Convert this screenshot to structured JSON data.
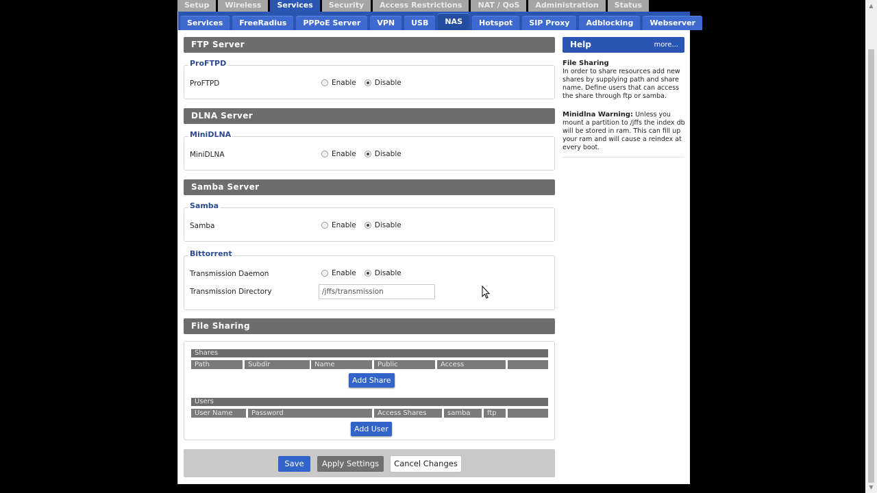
{
  "main_tabs": [
    {
      "label": "Setup",
      "active": false
    },
    {
      "label": "Wireless",
      "active": false
    },
    {
      "label": "Services",
      "active": true
    },
    {
      "label": "Security",
      "active": false
    },
    {
      "label": "Access Restrictions",
      "active": false
    },
    {
      "label": "NAT / QoS",
      "active": false
    },
    {
      "label": "Administration",
      "active": false
    },
    {
      "label": "Status",
      "active": false
    }
  ],
  "sub_tabs": [
    {
      "label": "Services",
      "active": false
    },
    {
      "label": "FreeRadius",
      "active": false
    },
    {
      "label": "PPPoE Server",
      "active": false
    },
    {
      "label": "VPN",
      "active": false
    },
    {
      "label": "USB",
      "active": false
    },
    {
      "label": "NAS",
      "active": true
    },
    {
      "label": "Hotspot",
      "active": false
    },
    {
      "label": "SIP Proxy",
      "active": false
    },
    {
      "label": "Adblocking",
      "active": false
    },
    {
      "label": "Webserver",
      "active": false
    }
  ],
  "sections": {
    "ftp": {
      "title": "FTP Server",
      "legend": "ProFTPD",
      "label": "ProFTPD"
    },
    "dlna": {
      "title": "DLNA Server",
      "legend": "MiniDLNA",
      "label": "MiniDLNA"
    },
    "samba": {
      "title": "Samba Server",
      "legend": "Samba",
      "label": "Samba"
    },
    "bittorrent": {
      "legend": "Bittorrent",
      "daemon_label": "Transmission Daemon",
      "dir_label": "Transmission Directory",
      "dir_value": "/jffs/transmission"
    },
    "file_sharing": {
      "title": "File Sharing",
      "shares_header": "Shares",
      "shares_columns": [
        "Path",
        "Subdir",
        "Name",
        "Public",
        "Access",
        ""
      ],
      "add_share": "Add Share",
      "users_header": "Users",
      "users_columns": [
        "User Name",
        "Password",
        "Access Shares",
        "samba",
        "ftp",
        ""
      ],
      "add_user": "Add User"
    }
  },
  "radio": {
    "enable": "Enable",
    "disable": "Disable",
    "selected": "disable"
  },
  "footer": {
    "save": "Save",
    "apply": "Apply Settings",
    "cancel": "Cancel Changes"
  },
  "help": {
    "title": "Help",
    "more": "more...",
    "file_sharing_title": "File Sharing",
    "file_sharing_text": "In order to share resources add new shares by supplying path and share name. Define users that can access the share through ftp or samba.",
    "minidlna_title": "Minidlna Warning:",
    "minidlna_text": "Unless you mount a partition to /jffs the index db will be stored in ram. This can fill up your ram and will cause a reindex at every boot."
  },
  "colors": {
    "accent": "#2b55b3",
    "section_bar": "#6d6d6d",
    "legend": "#2b4a8f"
  }
}
